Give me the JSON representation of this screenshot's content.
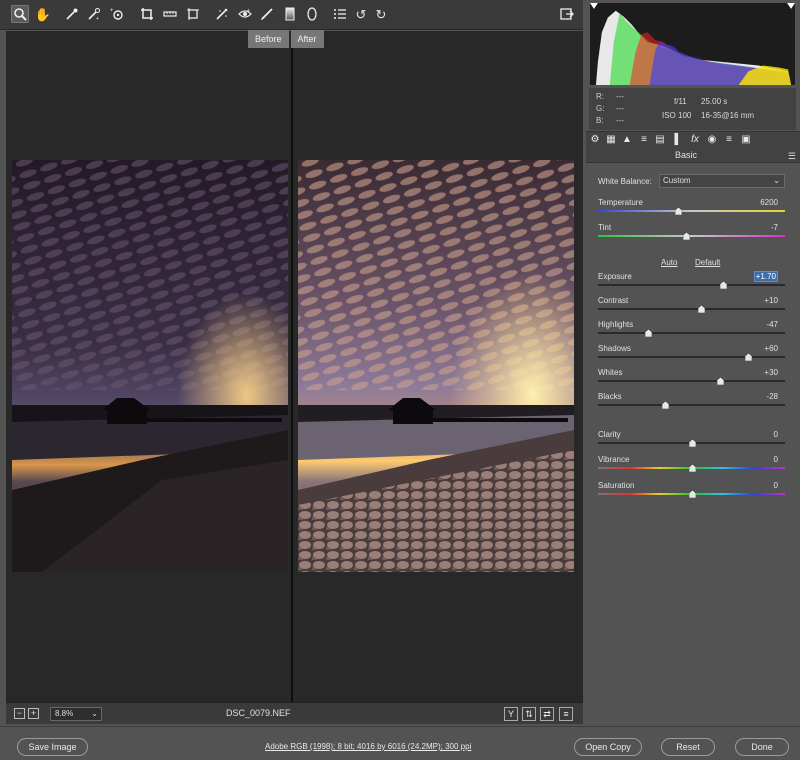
{
  "toolbar": {
    "tools": [
      {
        "name": "zoom-tool-icon",
        "glyph": "⌕",
        "active": true
      },
      {
        "name": "hand-tool-icon",
        "glyph": "✋"
      },
      {
        "name": "white-balance-tool-icon",
        "glyph": "✒"
      },
      {
        "name": "color-sampler-tool-icon",
        "glyph": "✒"
      },
      {
        "name": "targeted-adjustment-tool-icon",
        "glyph": "◎"
      },
      {
        "name": "crop-tool-icon",
        "glyph": "⌗"
      },
      {
        "name": "straighten-tool-icon",
        "glyph": "═"
      },
      {
        "name": "transform-tool-icon",
        "glyph": "▢"
      },
      {
        "name": "spot-removal-tool-icon",
        "glyph": "✦"
      },
      {
        "name": "red-eye-tool-icon",
        "glyph": "◉"
      },
      {
        "name": "adjustment-brush-icon",
        "glyph": "✎"
      },
      {
        "name": "graduated-filter-icon",
        "glyph": "▯"
      },
      {
        "name": "radial-filter-icon",
        "glyph": "⬭"
      },
      {
        "name": "preferences-icon",
        "glyph": "☰"
      },
      {
        "name": "rotate-left-icon",
        "glyph": "↺"
      },
      {
        "name": "rotate-right-icon",
        "glyph": "↻"
      }
    ],
    "fullscreen_glyph": "⇲"
  },
  "view_labels": {
    "before": "Before",
    "after": "After"
  },
  "preview_status": {
    "zoom_out": "−",
    "zoom_in": "+",
    "zoom_level": "8.8%",
    "filename": "DSC_0079.NEF",
    "view_buttons": [
      "Y",
      "⇅",
      "⇄",
      "≡"
    ]
  },
  "camera_info": {
    "r_label": "R:",
    "g_label": "G:",
    "b_label": "B:",
    "r_value": "---",
    "g_value": "---",
    "b_value": "---",
    "aperture": "f/11",
    "shutter": "25.00 s",
    "iso": "ISO 100",
    "lens": "16-35@16 mm"
  },
  "panel": {
    "title": "Basic",
    "tab_glyphs": [
      "⚙",
      "▦",
      "▲",
      "≡",
      "▤",
      "▌",
      "fx",
      "◉",
      "≡",
      "▣"
    ],
    "white_balance_label": "White Balance:",
    "white_balance_value": "Custom",
    "auto_label": "Auto",
    "default_label": "Default",
    "sliders": [
      {
        "id": "temperature",
        "label": "Temperature",
        "value": "6200",
        "level": 0.43
      },
      {
        "id": "tint",
        "label": "Tint",
        "value": "-7",
        "level": 0.47
      },
      {
        "id": "exposure",
        "label": "Exposure",
        "value": "+1.70",
        "level": 0.67,
        "selected": true
      },
      {
        "id": "contrast",
        "label": "Contrast",
        "value": "+10",
        "level": 0.55
      },
      {
        "id": "highlights",
        "label": "Highlights",
        "value": "-47",
        "level": 0.27
      },
      {
        "id": "shadows",
        "label": "Shadows",
        "value": "+60",
        "level": 0.8
      },
      {
        "id": "whites",
        "label": "Whites",
        "value": "+30",
        "level": 0.65
      },
      {
        "id": "blacks",
        "label": "Blacks",
        "value": "-28",
        "level": 0.36
      },
      {
        "id": "clarity",
        "label": "Clarity",
        "value": "0",
        "level": 0.5
      },
      {
        "id": "vibrance",
        "label": "Vibrance",
        "value": "0",
        "level": 0.5
      },
      {
        "id": "saturation",
        "label": "Saturation",
        "value": "0",
        "level": 0.5
      }
    ]
  },
  "bottom_bar": {
    "save_image": "Save Image",
    "workflow": "Adobe RGB (1998); 8 bit; 4016 by 6016 (24.2MP); 300 ppi",
    "open_copy": "Open Copy",
    "reset": "Reset",
    "done": "Done"
  }
}
